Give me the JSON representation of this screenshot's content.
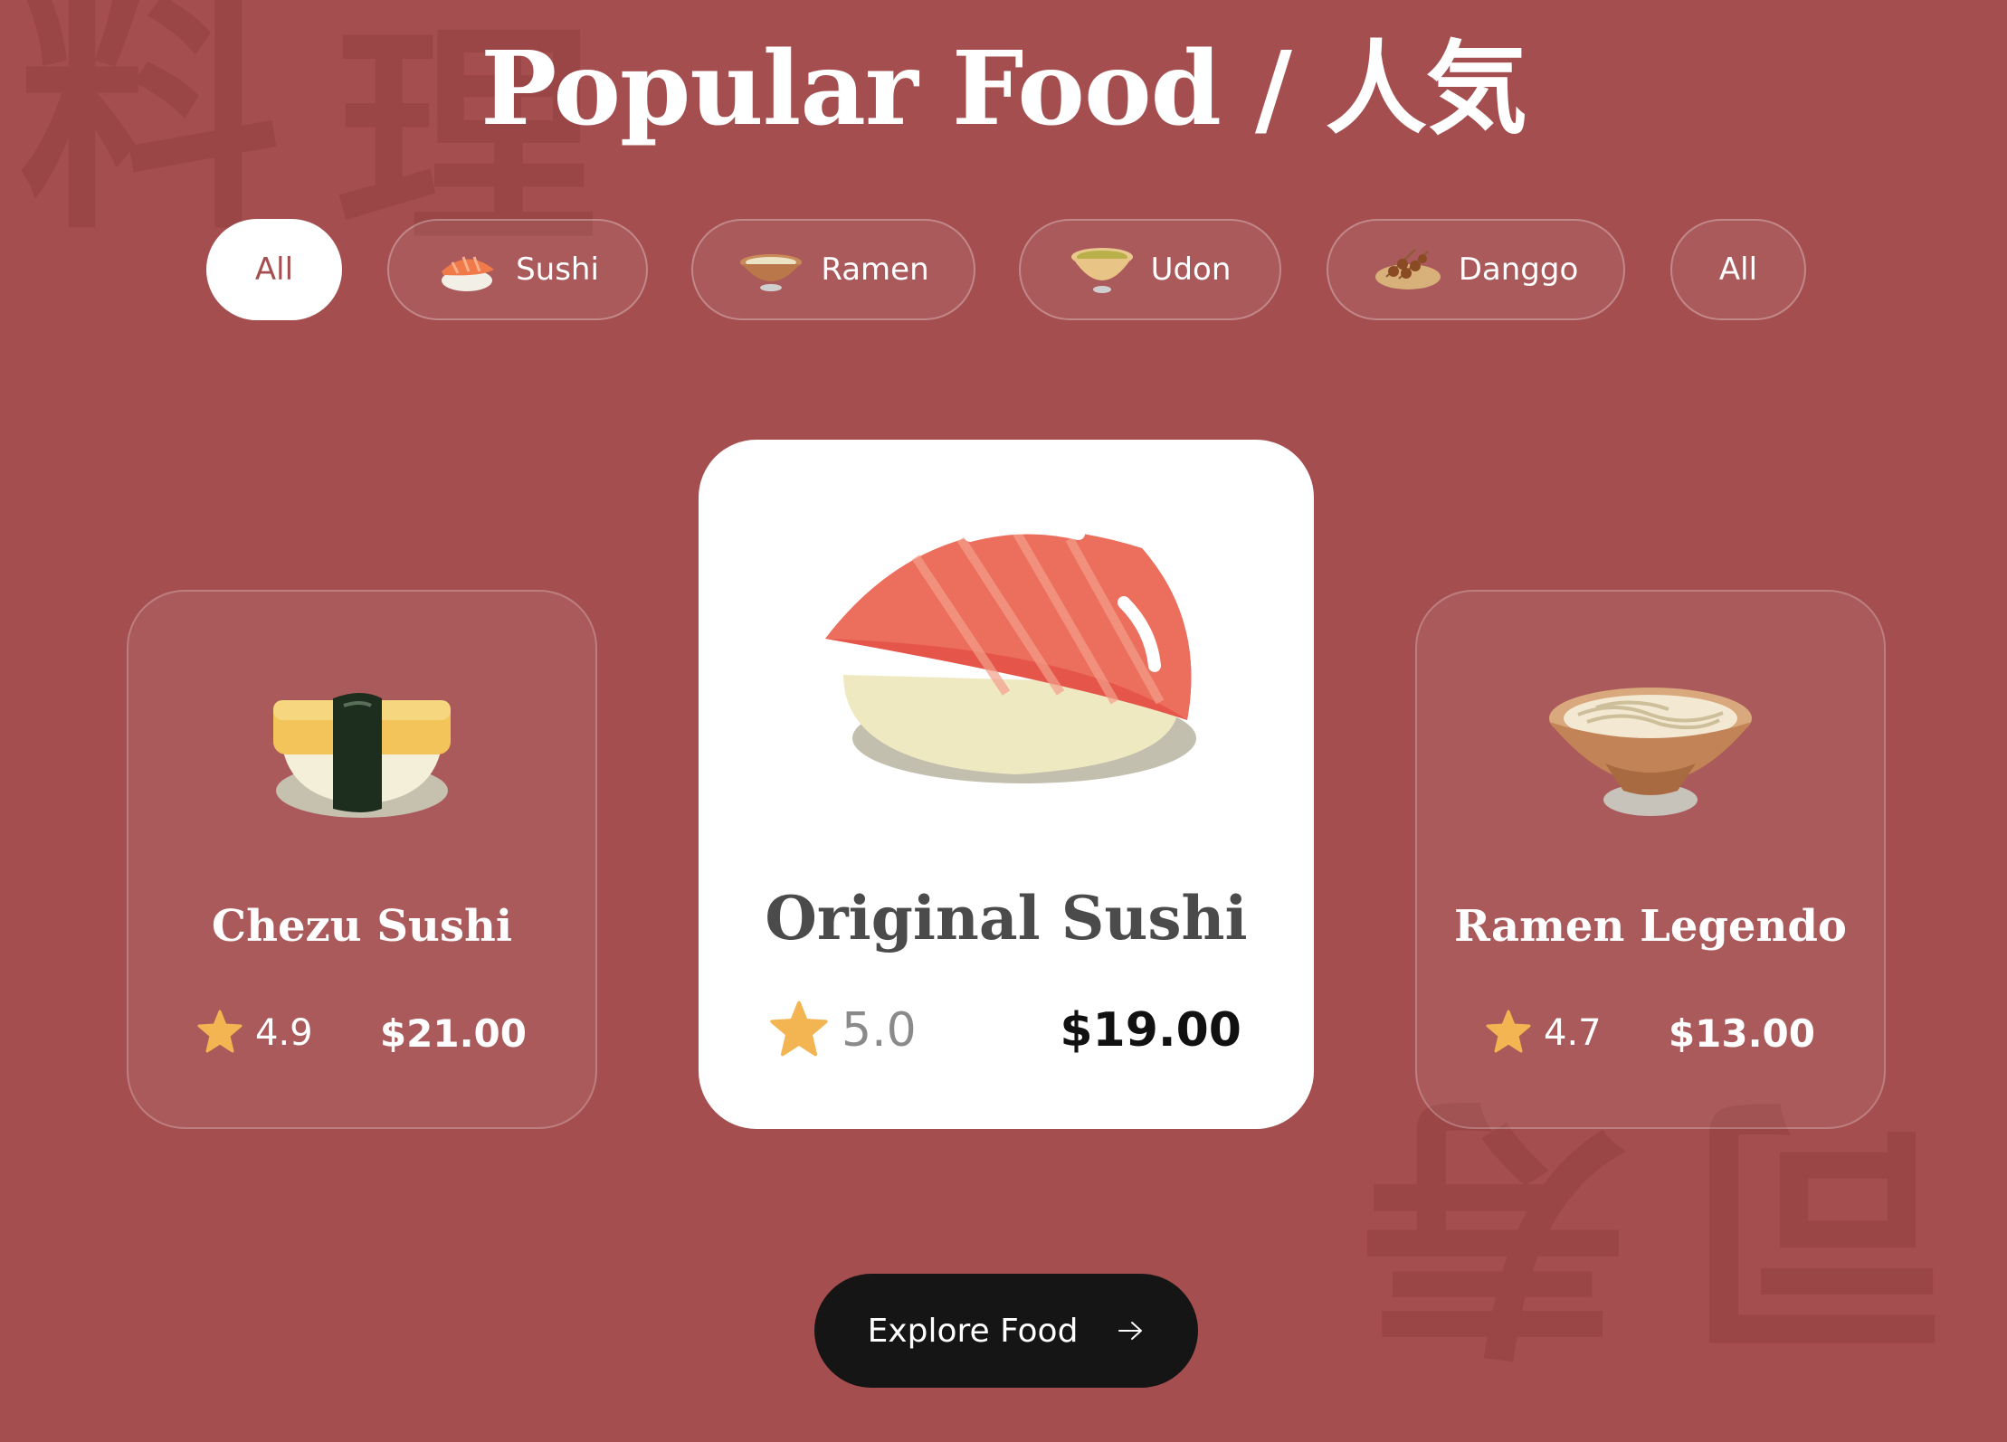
{
  "watermarks": [
    "料",
    "理",
    "寿",
    "司"
  ],
  "header": {
    "title": "Popular Food / 人気"
  },
  "filters": [
    {
      "label": "All",
      "icon": null,
      "active": true
    },
    {
      "label": "Sushi",
      "icon": "sushi-icon",
      "active": false
    },
    {
      "label": "Ramen",
      "icon": "ramen-bowl-icon",
      "active": false
    },
    {
      "label": "Udon",
      "icon": "udon-bowl-icon",
      "active": false
    },
    {
      "label": "Danggo",
      "icon": "dango-plate-icon",
      "active": false
    },
    {
      "label": "All",
      "icon": null,
      "active": false
    }
  ],
  "cards": [
    {
      "name": "Chezu Sushi",
      "rating": "4.9",
      "price": "$21.00",
      "image": "tamago-sushi-image"
    },
    {
      "name": "Original Sushi",
      "rating": "5.0",
      "price": "$19.00",
      "image": "salmon-nigiri-image",
      "featured": true
    },
    {
      "name": "Ramen Legendo",
      "rating": "4.7",
      "price": "$13.00",
      "image": "ramen-bowl-image"
    }
  ],
  "cta": {
    "label": "Explore Food",
    "icon": "arrow-right-icon"
  },
  "colors": {
    "background": "#a54e4f",
    "card_featured": "#ffffff",
    "star": "#f2b552",
    "button": "#151515",
    "text_light": "#ffffff"
  }
}
